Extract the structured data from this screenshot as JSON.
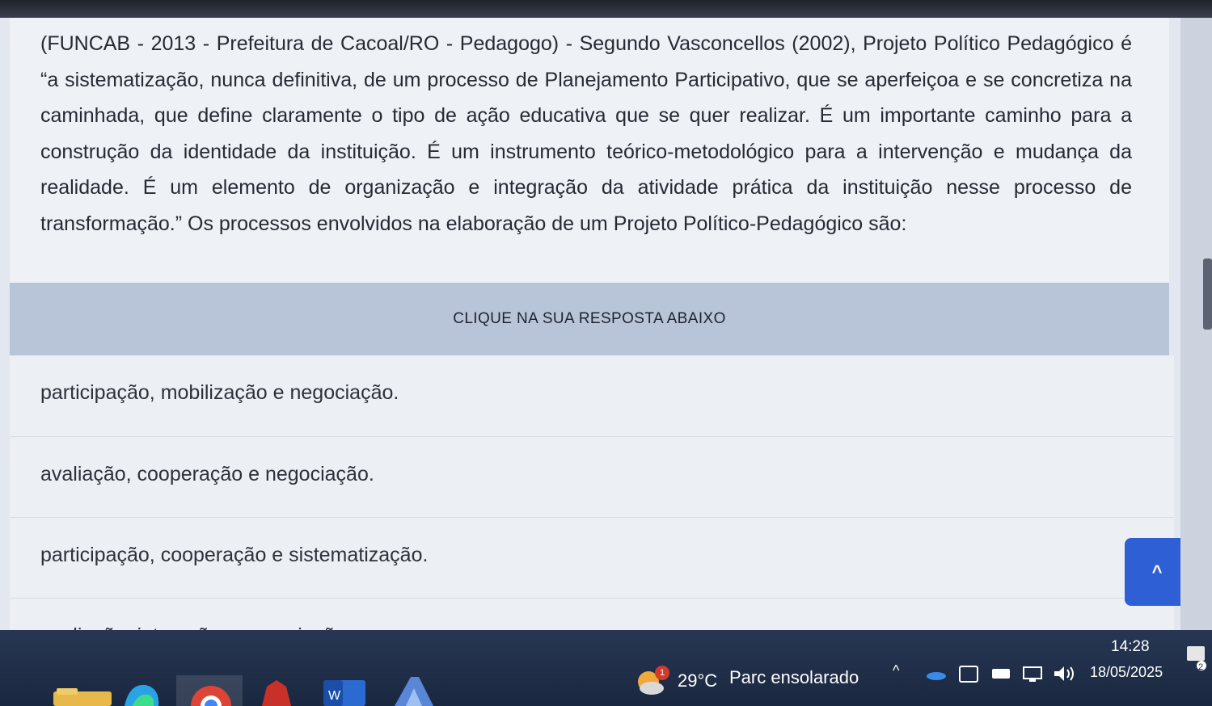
{
  "question": {
    "text": "(FUNCAB - 2013 - Prefeitura de Cacoal/RO - Pedagogo) - Segundo Vasconcellos (2002), Projeto Político Pedagógico é “a sistematização, nunca definitiva, de um processo de Planejamento Participativo, que se aperfeiçoa e se concretiza na caminhada, que define claramente o tipo de ação educativa que se quer realizar. É um importante caminho para a construção da identidade da instituição. É um instrumento teórico-metodológico para a intervenção e mudança da realidade. É um elemento de organização e integração da atividade prática da instituição nesse processo de transformação.” Os processos envolvidos na elaboração de um Projeto Político-Pedagógico são:"
  },
  "banner": {
    "label": "CLIQUE NA SUA RESPOSTA ABAIXO"
  },
  "answers": [
    "participação, mobilização e negociação.",
    "avaliação, cooperação e negociação.",
    "participação, cooperação e sistematização.",
    "avaliação, interação e negociação."
  ],
  "scroll_top_button": {
    "label": "^"
  },
  "taskbar": {
    "weather": {
      "badge": "1",
      "temperature": "29°C",
      "description": "Parc ensolarado"
    },
    "clock": {
      "time": "14:28",
      "date": "18/05/2025"
    },
    "notification_count": "2",
    "colors": {
      "accent": "#2f5fd4",
      "taskbar": "#1a2740"
    }
  }
}
